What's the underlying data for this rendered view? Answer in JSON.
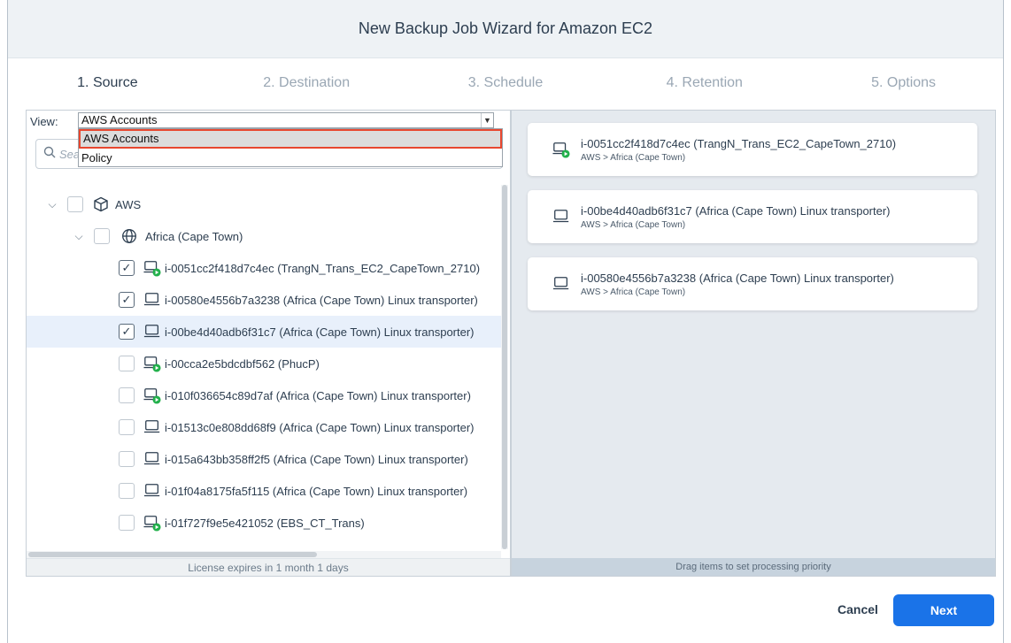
{
  "window": {
    "title": "New Backup Job Wizard for Amazon EC2"
  },
  "steps": [
    {
      "label": "1. Source",
      "active": true
    },
    {
      "label": "2. Destination",
      "active": false
    },
    {
      "label": "3. Schedule",
      "active": false
    },
    {
      "label": "4. Retention",
      "active": false
    },
    {
      "label": "5. Options",
      "active": false
    }
  ],
  "view": {
    "label": "View:",
    "selected": "AWS Accounts",
    "options": [
      "AWS Accounts",
      "Policy"
    ]
  },
  "search": {
    "placeholder": "Sea"
  },
  "tree": {
    "root": {
      "label": "AWS",
      "icon": "cube-icon",
      "checked": false,
      "expanded": true
    },
    "region": {
      "label": "Africa (Cape Town)",
      "icon": "globe-icon",
      "checked": false,
      "expanded": true
    },
    "instances": [
      {
        "label": "i-0051cc2f418d7c4ec (TrangN_Trans_EC2_CapeTown_2710)",
        "checked": true,
        "running": true,
        "highlighted": false
      },
      {
        "label": "i-00580e4556b7a3238 (Africa (Cape Town) Linux transporter)",
        "checked": true,
        "running": false,
        "highlighted": false
      },
      {
        "label": "i-00be4d40adb6f31c7 (Africa (Cape Town) Linux transporter)",
        "checked": true,
        "running": false,
        "highlighted": true
      },
      {
        "label": "i-00cca2e5bdcdbf562 (PhucP)",
        "checked": false,
        "running": true,
        "highlighted": false
      },
      {
        "label": "i-010f036654c89d7af (Africa (Cape Town) Linux transporter)",
        "checked": false,
        "running": true,
        "highlighted": false
      },
      {
        "label": "i-01513c0e808dd68f9 (Africa (Cape Town) Linux transporter)",
        "checked": false,
        "running": false,
        "highlighted": false
      },
      {
        "label": "i-015a643bb358ff2f5 (Africa (Cape Town) Linux transporter)",
        "checked": false,
        "running": false,
        "highlighted": false
      },
      {
        "label": "i-01f04a8175fa5f115 (Africa (Cape Town) Linux transporter)",
        "checked": false,
        "running": false,
        "highlighted": false
      },
      {
        "label": "i-01f727f9e5e421052 (EBS_CT_Trans)",
        "checked": false,
        "running": true,
        "highlighted": false
      }
    ]
  },
  "license_text": "License expires in 1 month 1 days",
  "selected_items": [
    {
      "title": "i-0051cc2f418d7c4ec (TrangN_Trans_EC2_CapeTown_2710)",
      "path": "AWS > Africa (Cape Town)",
      "running": true
    },
    {
      "title": "i-00be4d40adb6f31c7 (Africa (Cape Town) Linux transporter)",
      "path": "AWS > Africa (Cape Town)",
      "running": false
    },
    {
      "title": "i-00580e4556b7a3238 (Africa (Cape Town) Linux transporter)",
      "path": "AWS > Africa (Cape Town)",
      "running": false
    }
  ],
  "drag_note": "Drag items to set processing priority",
  "buttons": {
    "cancel": "Cancel",
    "next": "Next"
  },
  "colors": {
    "accent": "#1a73e8",
    "highlight_row": "#e8f0fb",
    "dropdown_outline": "#e8472f",
    "running_badge": "#22b04b"
  }
}
